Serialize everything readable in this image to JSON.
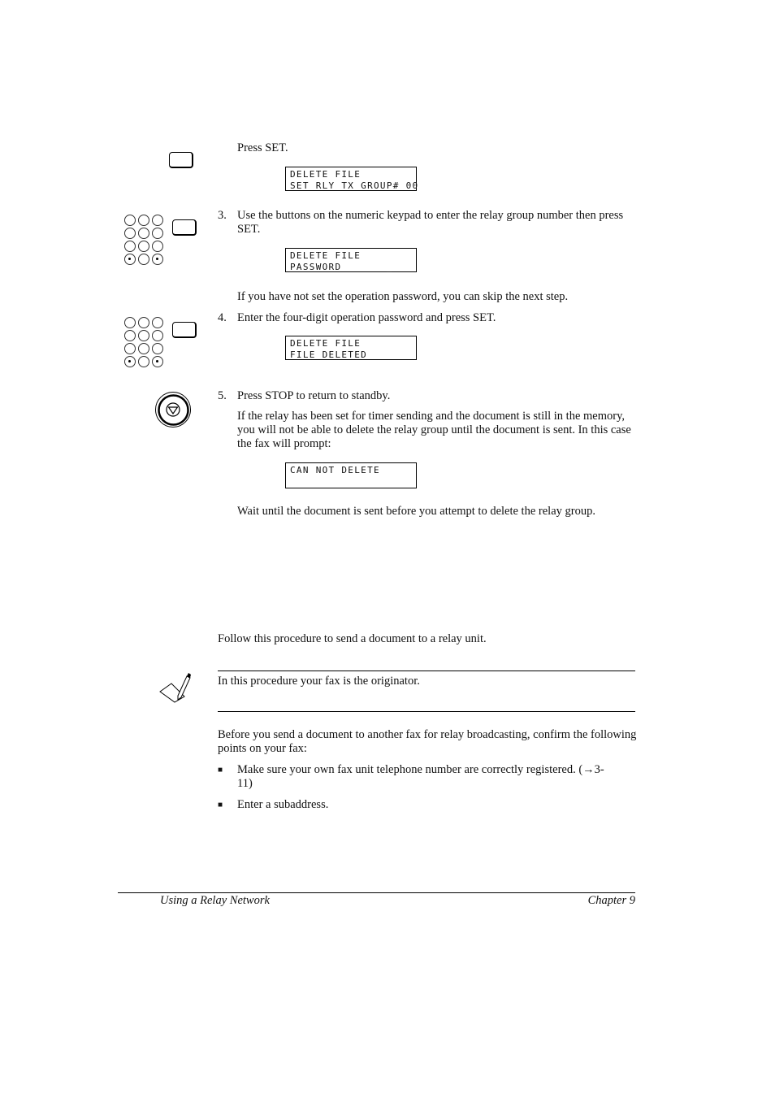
{
  "steps": {
    "press_set": "Press SET.",
    "lcd1": [
      "DELETE FILE",
      "SET RLY TX GROUP# 00"
    ],
    "step3_num": "3.",
    "step3_text": "Use the buttons on the numeric keypad to enter the relay group number then press SET.",
    "lcd2": [
      "DELETE FILE",
      "PASSWORD       _"
    ],
    "skip_note": "If you have not set the operation password, you can skip the next step.",
    "step4_num": "4.",
    "step4_text": "Enter the four-digit operation password and press SET.",
    "lcd3": [
      "DELETE FILE",
      "FILE DELETED"
    ],
    "step5_num": "5.",
    "step5_text": "Press STOP to return to standby.",
    "timer_note": "If the relay has been set for timer sending and the document is still in the memory, you will not be able to delete the relay group until the document is sent. In this case the fax will prompt:",
    "lcd4": [
      "CAN NOT DELETE",
      ""
    ],
    "wait_note": "Wait until the document is sent before you attempt to delete the relay group."
  },
  "section": {
    "intro": "Follow this procedure to send a document to a relay unit.",
    "note": "In this procedure your fax is the originator.",
    "before": "Before you send a document to another fax for relay broadcasting, confirm the following points on your fax:",
    "bullets": [
      "Make sure your own fax unit telephone number are correctly registered. (→3-11)",
      "Enter a subaddress."
    ],
    "bullet_glyph": "■"
  },
  "footer": {
    "left": "Using a Relay Network",
    "right": "Chapter 9"
  }
}
